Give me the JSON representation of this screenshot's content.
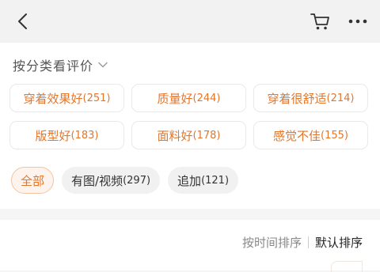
{
  "header": {
    "back_icon": "chevron-left-icon",
    "cart_icon": "cart-icon",
    "more_icon": "more-dots-icon"
  },
  "category": {
    "title": "按分类看评价",
    "chevron_icon": "chevron-down-icon",
    "tags": [
      {
        "label": "穿着效果好",
        "count": "(251)"
      },
      {
        "label": "质量好",
        "count": "(244)"
      },
      {
        "label": "穿着很舒适",
        "count": "(214)"
      },
      {
        "label": "版型好",
        "count": "(183)"
      },
      {
        "label": "面料好",
        "count": "(178)"
      },
      {
        "label": "感觉不佳",
        "count": "(155)"
      }
    ]
  },
  "filters": [
    {
      "label": "全部",
      "count": "",
      "active": true
    },
    {
      "label": "有图/视频",
      "count": "(297)",
      "active": false
    },
    {
      "label": "追加",
      "count": "(121)",
      "active": false
    }
  ],
  "sort": {
    "by_time": "按时间排序",
    "default": "默认排序"
  },
  "colors": {
    "accent": "#e4762a",
    "background": "#f5f5f5"
  }
}
